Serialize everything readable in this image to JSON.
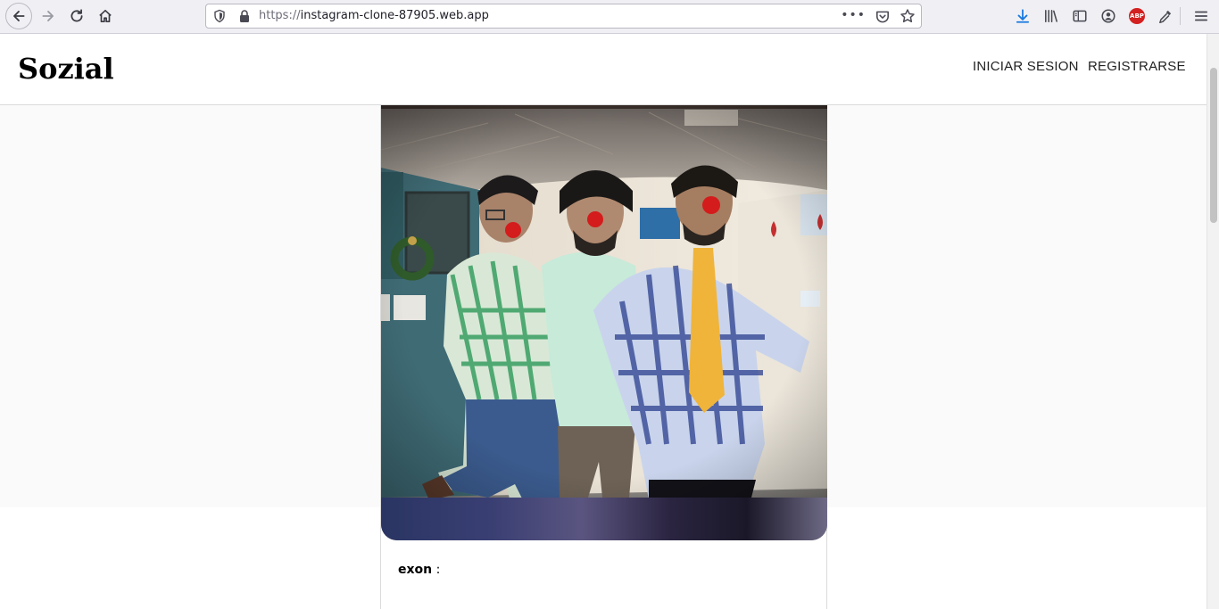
{
  "browser": {
    "url_protocol": "https://",
    "url_host": "instagram-clone-87905.web.app",
    "url_more": "•••",
    "abp_label": "ABP",
    "icons": [
      "back-arrow-icon",
      "forward-arrow-icon",
      "reload-icon",
      "home-icon",
      "shield-icon",
      "lock-icon",
      "pocket-icon",
      "star-icon",
      "download-icon",
      "library-icon",
      "sidebar-icon",
      "account-icon",
      "adblock-icon",
      "eyedropper-icon",
      "hamburger-menu-icon"
    ]
  },
  "header": {
    "brand": "Sozial",
    "login_label": "INICIAR SESION",
    "register_label": "REGISTRARSE"
  },
  "post": {
    "username": "exon",
    "separator": " :",
    "image_alt": "three friends wearing red clown noses in a hallway"
  },
  "colors": {
    "brand": "#000000",
    "page_band": "#fafafa",
    "border": "#dbdbdb",
    "download_accent": "#1a7ae0",
    "abp_red": "#d32020"
  }
}
